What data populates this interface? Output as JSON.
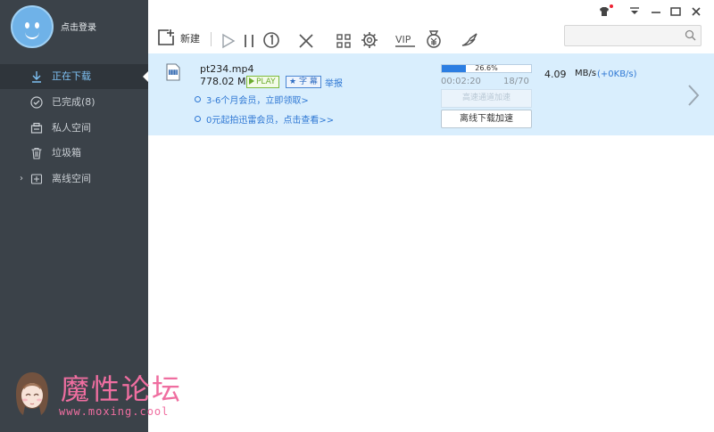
{
  "sidebar": {
    "login_text": "点击登录",
    "items": [
      {
        "label": "正在下载",
        "icon": "download-arrow-icon"
      },
      {
        "label": "已完成(8)",
        "icon": "check-circle-icon"
      },
      {
        "label": "私人空间",
        "icon": "private-space-icon"
      },
      {
        "label": "垃圾箱",
        "icon": "trash-icon"
      },
      {
        "label": "离线空间",
        "icon": "offline-space-icon"
      }
    ]
  },
  "toolbar": {
    "new_label": "新建",
    "vip_label": "VIP",
    "search_placeholder": ""
  },
  "task": {
    "file_name": "pt234.mp4",
    "file_size": "778.02 MB",
    "play_badge": "PLAY",
    "subtitle_badge": "字 幕",
    "report_link": "举报",
    "promo_1": "3-6个月会员，立即领取>",
    "promo_2": "0元起拍迅雷会员，点击查看>>",
    "progress": 0.266,
    "progress_text": "26.6%",
    "elapsed": "00:02:20",
    "pieces": "18/70",
    "speed_value": "4.09",
    "speed_unit": "MB/s",
    "speed_boost": "(+0KB/s)",
    "accel_button": "高速通道加速",
    "offline_button": "离线下载加速"
  },
  "watermark": {
    "title": "魔性论坛",
    "url": "www.moxing.cool"
  },
  "colors": {
    "sidebar_bg": "#3b4249",
    "active_text": "#7ec0f2",
    "task_bg": "#d9eefd",
    "progress_fill": "#2c7ee2",
    "link": "#2f78d4",
    "watermark": "#ef6ea0"
  }
}
